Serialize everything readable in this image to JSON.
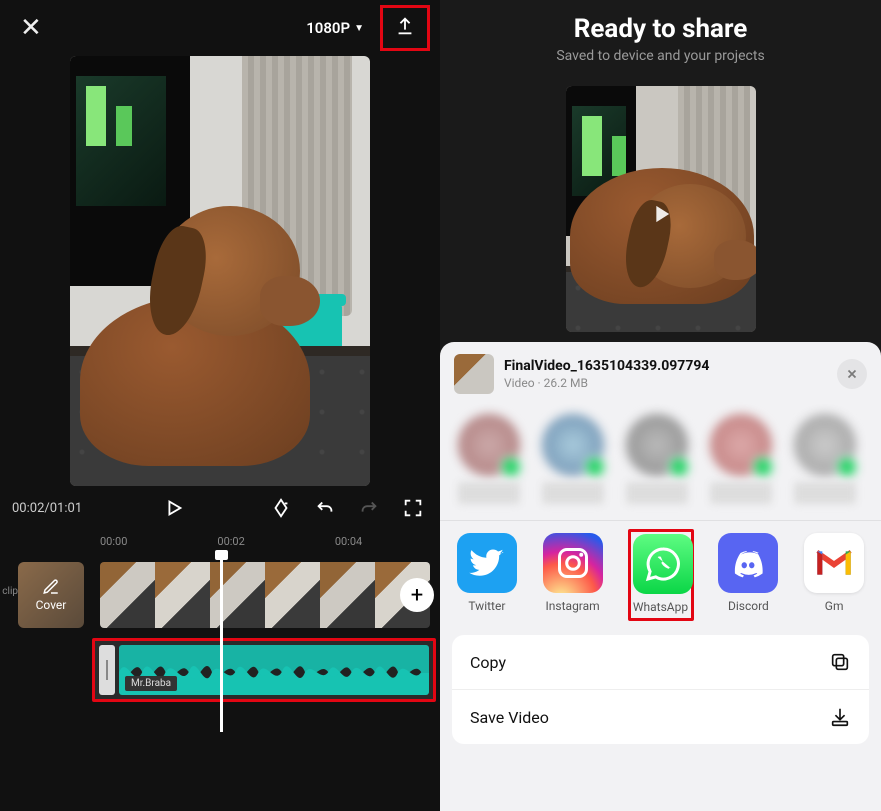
{
  "editor": {
    "resolution_label": "1080P",
    "time_current": "00:02",
    "time_total": "01:01",
    "ruler": [
      "00:00",
      "00:02",
      "00:04"
    ],
    "cover_label": "Cover",
    "clip_label": "clip",
    "audio_track_label": "Mr.Braba",
    "add_label": "+"
  },
  "share": {
    "title": "Ready to share",
    "subtitle": "Saved to device and your projects",
    "file": {
      "name": "FinalVideo_1635104339.097794",
      "type_label": "Video",
      "size_label": "26.2 MB"
    },
    "apps": {
      "twitter": "Twitter",
      "instagram": "Instagram",
      "whatsapp": "WhatsApp",
      "discord": "Discord",
      "gmail": "Gm"
    },
    "actions": {
      "copy": "Copy",
      "save_video": "Save Video"
    }
  }
}
